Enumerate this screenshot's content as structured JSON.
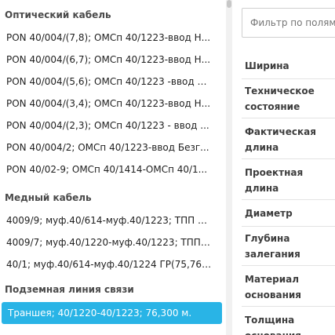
{
  "sections": [
    {
      "title": "Оптический кабель",
      "items": [
        "PON 40/004/(7,8); ОМСп 40/1223-ввод Н...",
        "PON 40/004/(6,7); ОМСп 40/1223-ввод Н...",
        "PON 40/004/(5,6); ОМСп 40/1223 -ввод Н...",
        "PON 40/004/(3,4); ОМСп 40/1223-ввод Н...",
        "PON 40/004/(2,3); ОМСп 40/1223 - ввод ...",
        "PON 40/004/2; ОМСп 40/1223-ввод Безг...",
        "PON 40/02-9; ОМСп 40/1414-ОМСп 40/1..."
      ]
    },
    {
      "title": "Медный кабель",
      "items": [
        "4009/9; муф.40/614-муф.40/1223; ТПП 10...",
        "4009/7; муф.40/1220-муф.40/1223; ТПП 1...",
        "40/1; муф.40/614-муф.40/1224 ГР(75,76,7..."
      ]
    },
    {
      "title": "Подземная линия связи",
      "items": [
        "Траншея; 40/1220-40/1223; 76,300 м."
      ]
    }
  ],
  "filter": {
    "placeholder": "Фильтр по полям"
  },
  "fields": [
    "Ширина",
    "Техническое состояние",
    "Фактическая длина",
    "Проектная длина",
    "Диаметр",
    "Глубина залегания",
    "Материал основания",
    "Толщина основания"
  ],
  "colors": {
    "selected": "#29b4e6",
    "header": "#4a4a4a"
  }
}
